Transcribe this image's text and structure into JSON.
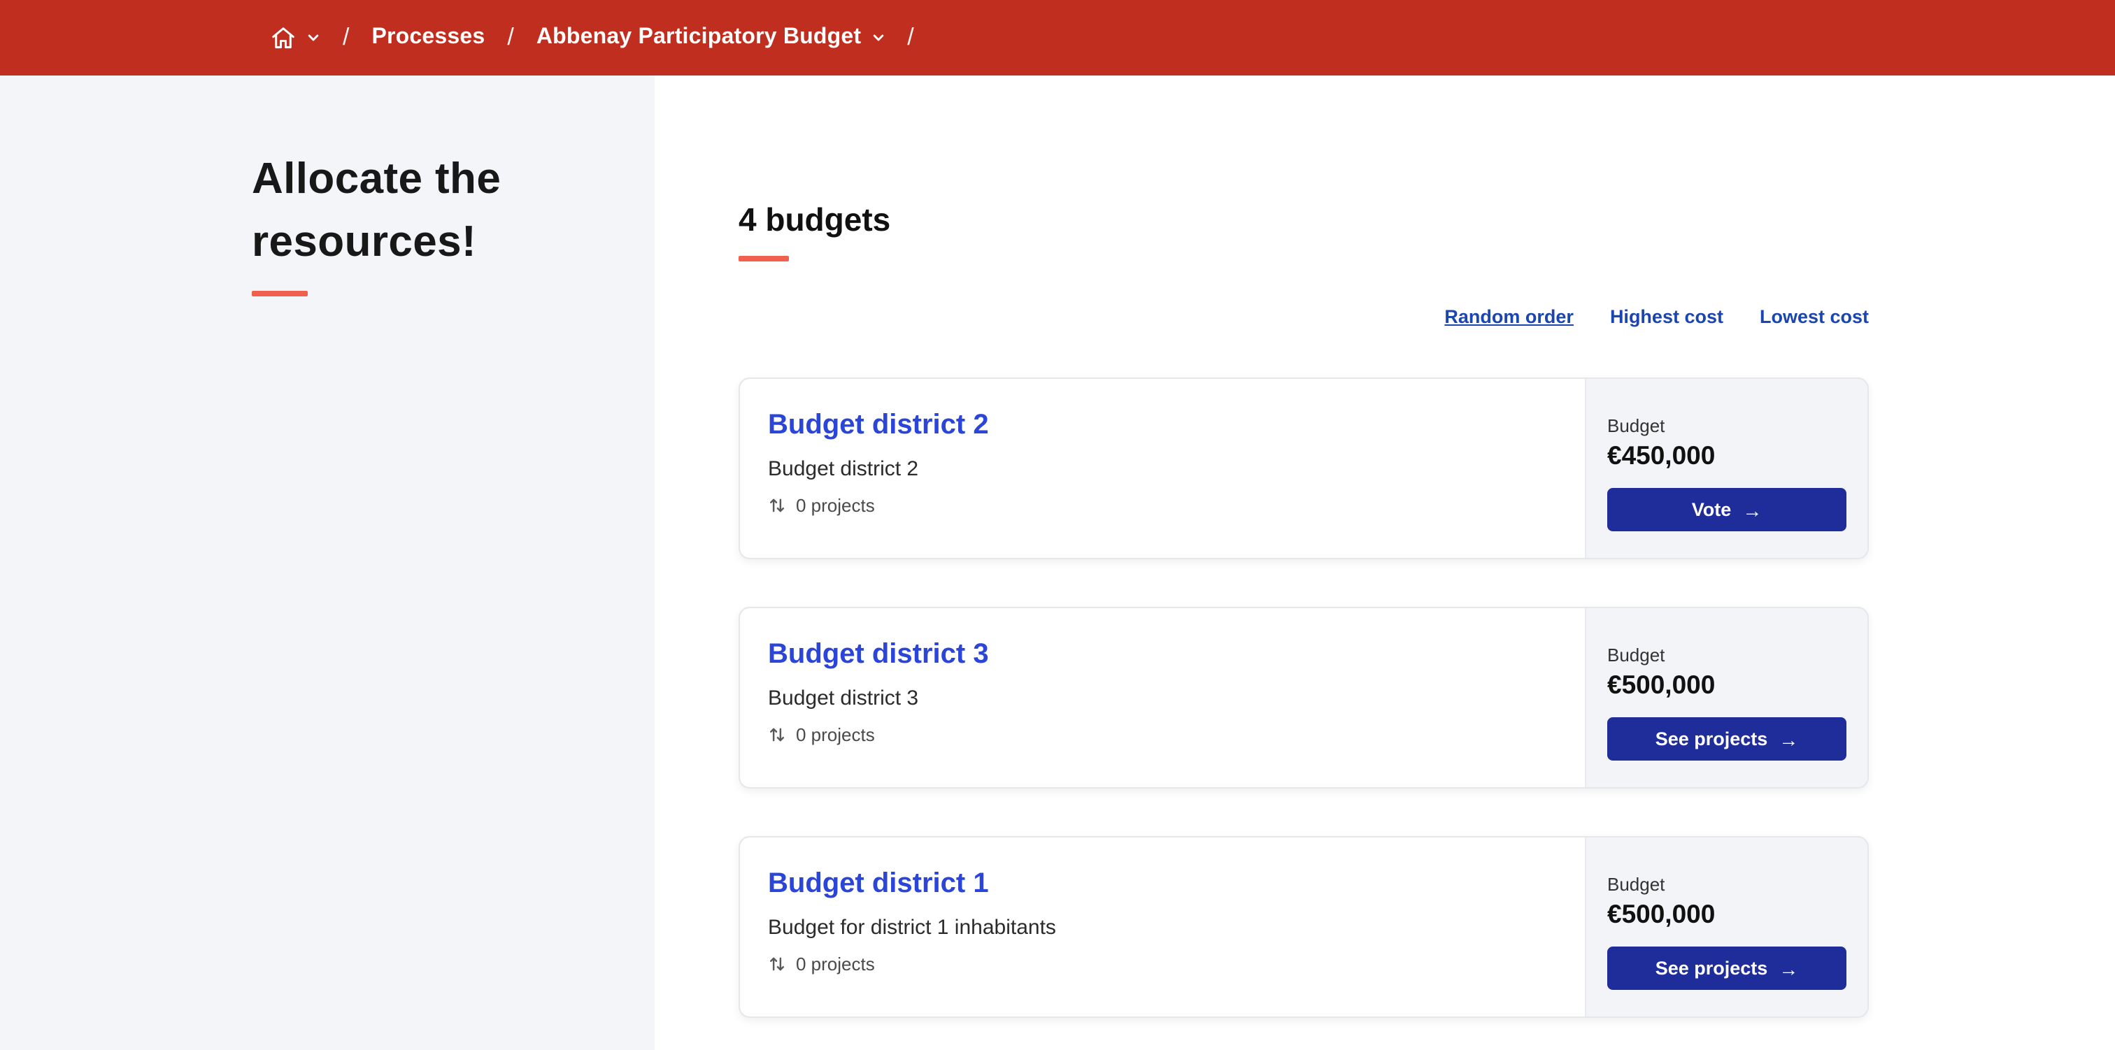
{
  "colors": {
    "header": "#bf2e1e",
    "accent": "#ef604d",
    "title": "#2b45d9",
    "button": "#1f2d9b",
    "link": "#1b46b0"
  },
  "breadcrumb": {
    "separator": "/",
    "processes_label": "Processes",
    "process_label": "Abbenay Participatory Budget"
  },
  "sidebar": {
    "title": "Allocate the resources!"
  },
  "icons": {
    "arrow": "→"
  },
  "main": {
    "heading": "4 budgets",
    "sort": [
      {
        "label": "Random order",
        "active": true
      },
      {
        "label": "Highest cost",
        "active": false
      },
      {
        "label": "Lowest cost",
        "active": false
      }
    ],
    "cards": [
      {
        "title": "Budget district 2",
        "subtitle": "Budget district 2",
        "projects": "0 projects",
        "budget_label": "Budget",
        "amount": "€450,000",
        "button": "Vote"
      },
      {
        "title": "Budget district 3",
        "subtitle": "Budget district 3",
        "projects": "0 projects",
        "budget_label": "Budget",
        "amount": "€500,000",
        "button": "See projects"
      },
      {
        "title": "Budget district 1",
        "subtitle": "Budget for district 1 inhabitants",
        "projects": "0 projects",
        "budget_label": "Budget",
        "amount": "€500,000",
        "button": "See projects"
      }
    ]
  }
}
